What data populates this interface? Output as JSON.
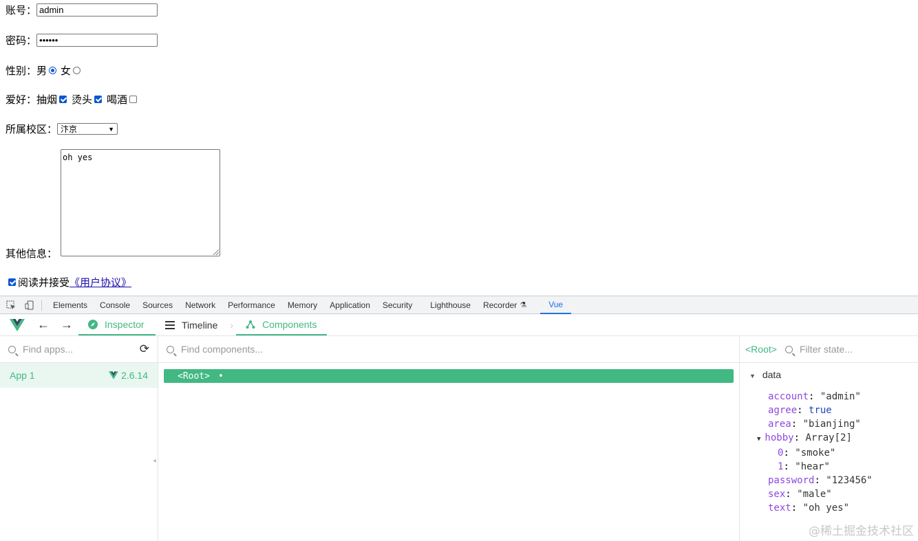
{
  "form": {
    "account_label": "账号：",
    "account_value": "admin",
    "password_label": "密码：",
    "password_value": "••••••",
    "sex_label": "性别：",
    "sex_male": "男",
    "sex_female": "女",
    "hobby_label": "爱好：",
    "hobby_smoke": "抽烟",
    "hobby_hair": "烫头",
    "hobby_drink": "喝酒",
    "area_label": "所属校区：",
    "area_value": "汴京",
    "other_label": "其他信息：",
    "other_value": "oh yes",
    "agree_text": "阅读并接受",
    "agree_link": "《用户协议》"
  },
  "devtools": {
    "tabs": [
      "Elements",
      "Console",
      "Sources",
      "Network",
      "Performance",
      "Memory",
      "Application",
      "Security",
      "Lighthouse",
      "Recorder",
      "Vue"
    ]
  },
  "vue": {
    "inspector": "Inspector",
    "timeline": "Timeline",
    "components": "Components",
    "find_apps": "Find apps...",
    "find_components": "Find components...",
    "app_name": "App 1",
    "version": "2.6.14",
    "root_label": "<Root>",
    "root_header": "<Root>",
    "filter_state": "Filter state...",
    "data_header": "data",
    "state": {
      "account_key": "account",
      "account_val": "\"admin\"",
      "agree_key": "agree",
      "agree_val": "true",
      "area_key": "area",
      "area_val": "\"bianjing\"",
      "hobby_key": "hobby",
      "hobby_val": "Array[2]",
      "hobby0_key": "0",
      "hobby0_val": "\"smoke\"",
      "hobby1_key": "1",
      "hobby1_val": "\"hear\"",
      "password_key": "password",
      "password_val": "\"123456\"",
      "sex_key": "sex",
      "sex_val": "\"male\"",
      "text_key": "text",
      "text_val": "\"oh yes\""
    }
  },
  "watermark": "@稀土掘金技术社区",
  "colors": {
    "vue_green": "#42b883",
    "devtools_blue": "#1a73e8",
    "checkbox_blue": "#0b57d0"
  }
}
